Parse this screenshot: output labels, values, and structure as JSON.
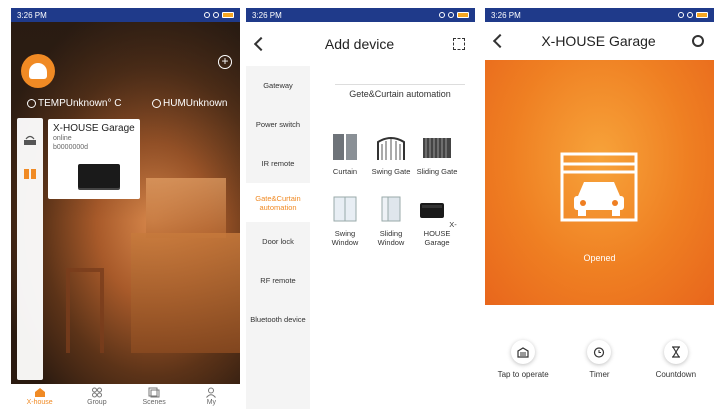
{
  "status_bar": {
    "time": "3:26 PM"
  },
  "screen_home": {
    "temperature": "TEMPUnknown° C",
    "humidity": "HUMUnknown",
    "device_card": {
      "title": "X-HOUSE Garage",
      "state": "online",
      "id": "b0000000d"
    },
    "tabs": [
      {
        "label": "X-house"
      },
      {
        "label": "Group"
      },
      {
        "label": "Scenes"
      },
      {
        "label": "My"
      }
    ],
    "colors": {
      "accent": "#f08a24",
      "status_bar": "#1f3a8a"
    }
  },
  "screen_add": {
    "title": "Add device",
    "categories": [
      {
        "label": "Gateway"
      },
      {
        "label": "Power switch"
      },
      {
        "label": "IR remote"
      },
      {
        "label": "Gate&Curtain automation"
      },
      {
        "label": "Door lock"
      },
      {
        "label": "RF remote"
      },
      {
        "label": "Bluetooth device"
      }
    ],
    "selected_category_index": 3,
    "section_title": "Gete&Curtain automation",
    "devices": [
      {
        "label": "Curtain"
      },
      {
        "label": "Swing Gate"
      },
      {
        "label": "Sliding Gate"
      },
      {
        "label": "Swing Window"
      },
      {
        "label": "Sliding Window"
      },
      {
        "label": "X-HOUSE Garage"
      }
    ]
  },
  "screen_device": {
    "title": "X-HOUSE Garage",
    "status": "Opened",
    "controls": [
      {
        "label": "Tap to operate"
      },
      {
        "label": "Timer"
      },
      {
        "label": "Countdown"
      }
    ],
    "colors": {
      "hero": "#ef7f22"
    }
  }
}
